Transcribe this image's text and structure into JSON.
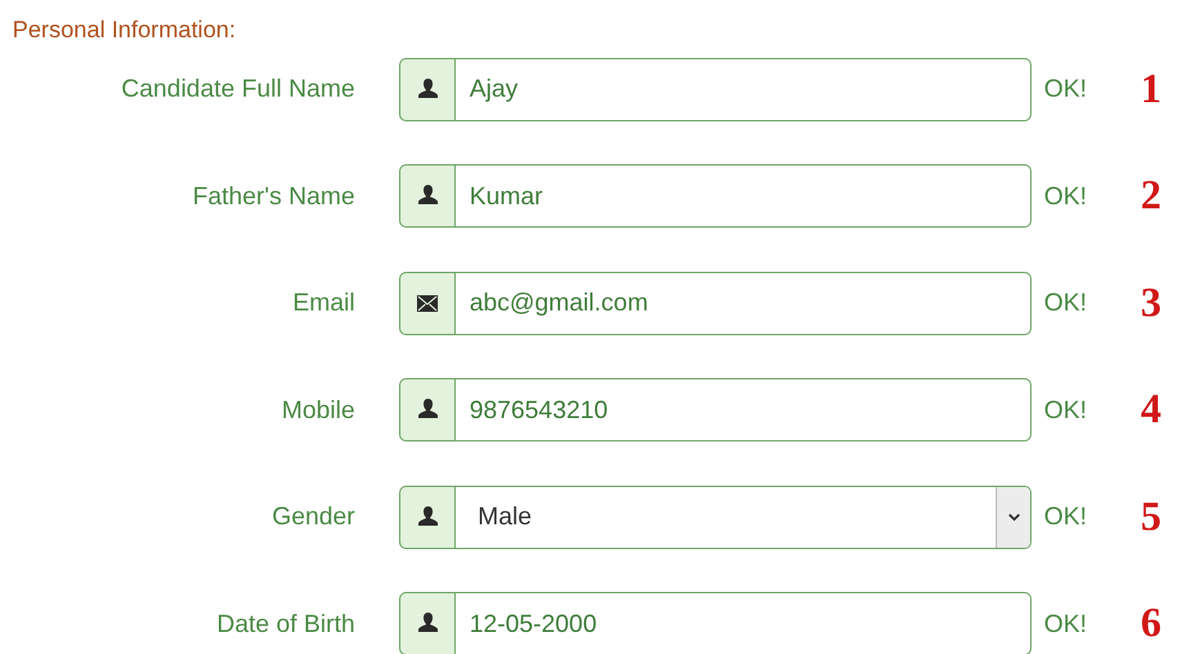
{
  "section_title": "Personal Information:",
  "fields": [
    {
      "label": "Candidate Full Name",
      "kind": "text",
      "value": "Ajay",
      "status": "OK!",
      "number": "1"
    },
    {
      "label": "Father's Name",
      "kind": "text",
      "value": "Kumar",
      "status": "OK!",
      "number": "2"
    },
    {
      "label": "Email",
      "kind": "email",
      "value": "abc@gmail.com",
      "status": "OK!",
      "number": "3"
    },
    {
      "label": "Mobile",
      "kind": "text",
      "value": "9876543210",
      "status": "OK!",
      "number": "4"
    },
    {
      "label": "Gender",
      "kind": "select",
      "value": "Male",
      "status": "OK!",
      "number": "5"
    },
    {
      "label": "Date of Birth",
      "kind": "text",
      "value": "12-05-2000",
      "status": "OK!",
      "number": "6"
    }
  ]
}
